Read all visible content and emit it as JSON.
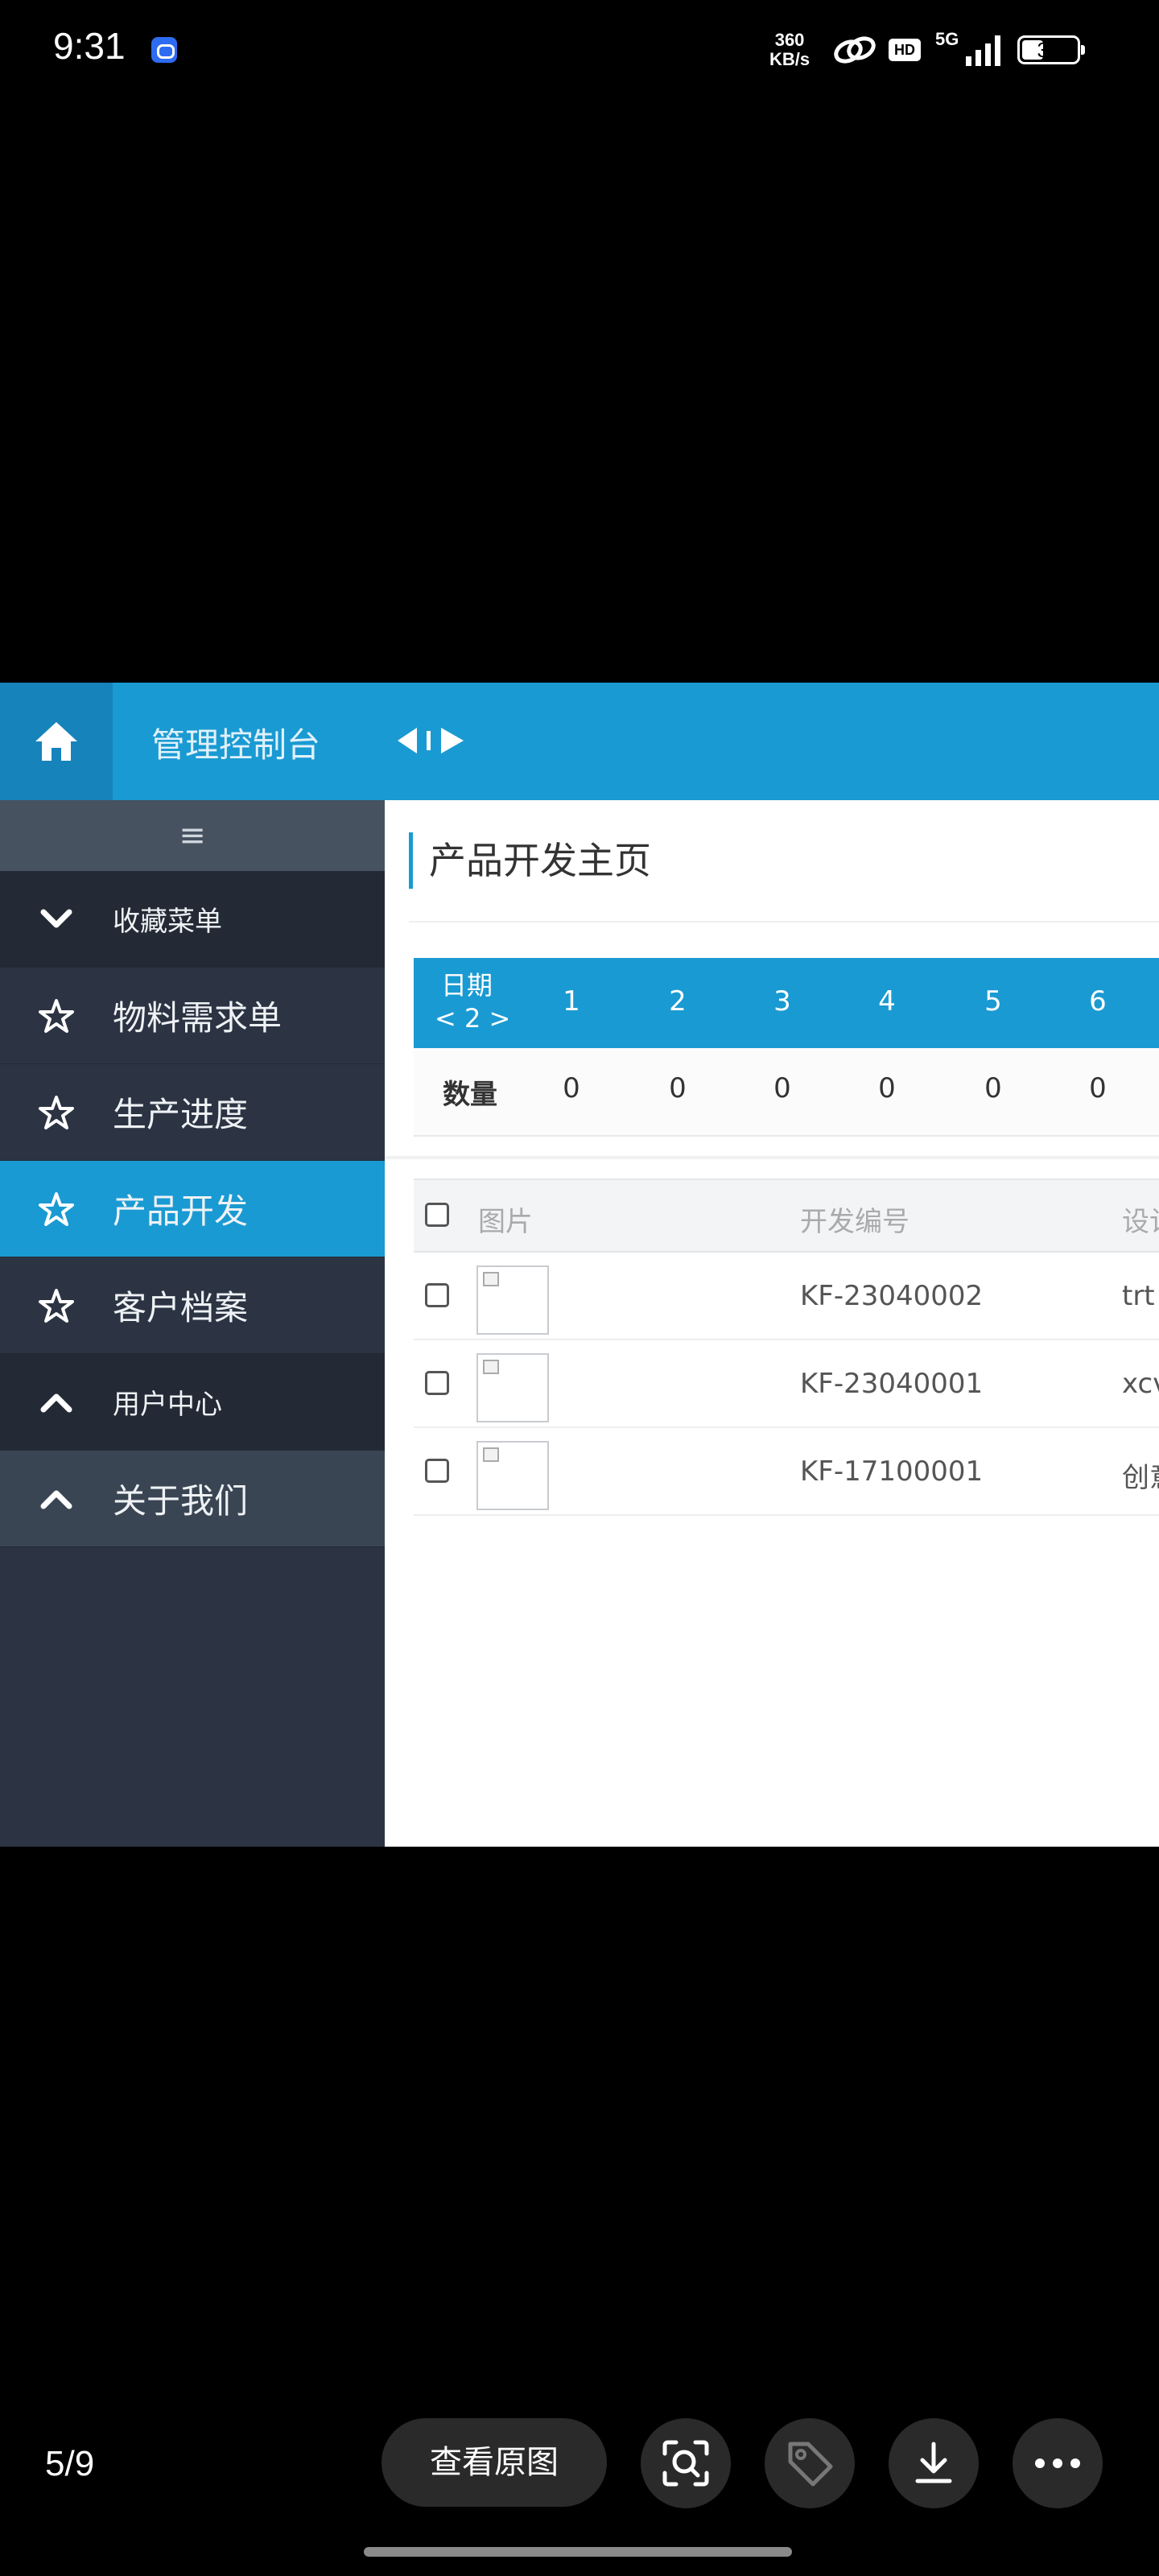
{
  "status_bar": {
    "time": "9:31",
    "net_speed_value": "360",
    "net_speed_unit": "KB/s",
    "hd": "HD",
    "network": "5G",
    "battery": "39",
    "battery_fraction": 0.39
  },
  "app": {
    "title": "管理控制台",
    "sidebar": {
      "handle": "≡",
      "items": [
        {
          "label": "收藏菜单",
          "icon": "chevron-down-icon",
          "kind": "group"
        },
        {
          "label": "物料需求单",
          "icon": "star-icon",
          "kind": "item"
        },
        {
          "label": "生产进度",
          "icon": "star-icon",
          "kind": "item"
        },
        {
          "label": "产品开发",
          "icon": "star-icon",
          "kind": "active"
        },
        {
          "label": "客户档案",
          "icon": "star-icon",
          "kind": "item"
        },
        {
          "label": "用户中心",
          "icon": "chevron-up-icon",
          "kind": "group"
        },
        {
          "label": "关于我们",
          "icon": "chevron-up-icon",
          "kind": "about"
        }
      ]
    },
    "page_title": "产品开发主页",
    "stats": {
      "date_label": "日期",
      "nav_label": "< 2 >",
      "qty_label": "数量",
      "days": [
        "1",
        "2",
        "3",
        "4",
        "5",
        "6"
      ],
      "quantities": [
        "0",
        "0",
        "0",
        "0",
        "0",
        "0"
      ]
    },
    "grid": {
      "headers": {
        "image": "图片",
        "code": "开发编号",
        "design": "设计"
      },
      "rows": [
        {
          "code": "KF-23040002",
          "design": "trt"
        },
        {
          "code": "KF-23040001",
          "design": "xcv"
        },
        {
          "code": "KF-17100001",
          "design": "创意"
        }
      ]
    }
  },
  "viewer": {
    "counter": "5/9",
    "view_original": "查看原图"
  }
}
